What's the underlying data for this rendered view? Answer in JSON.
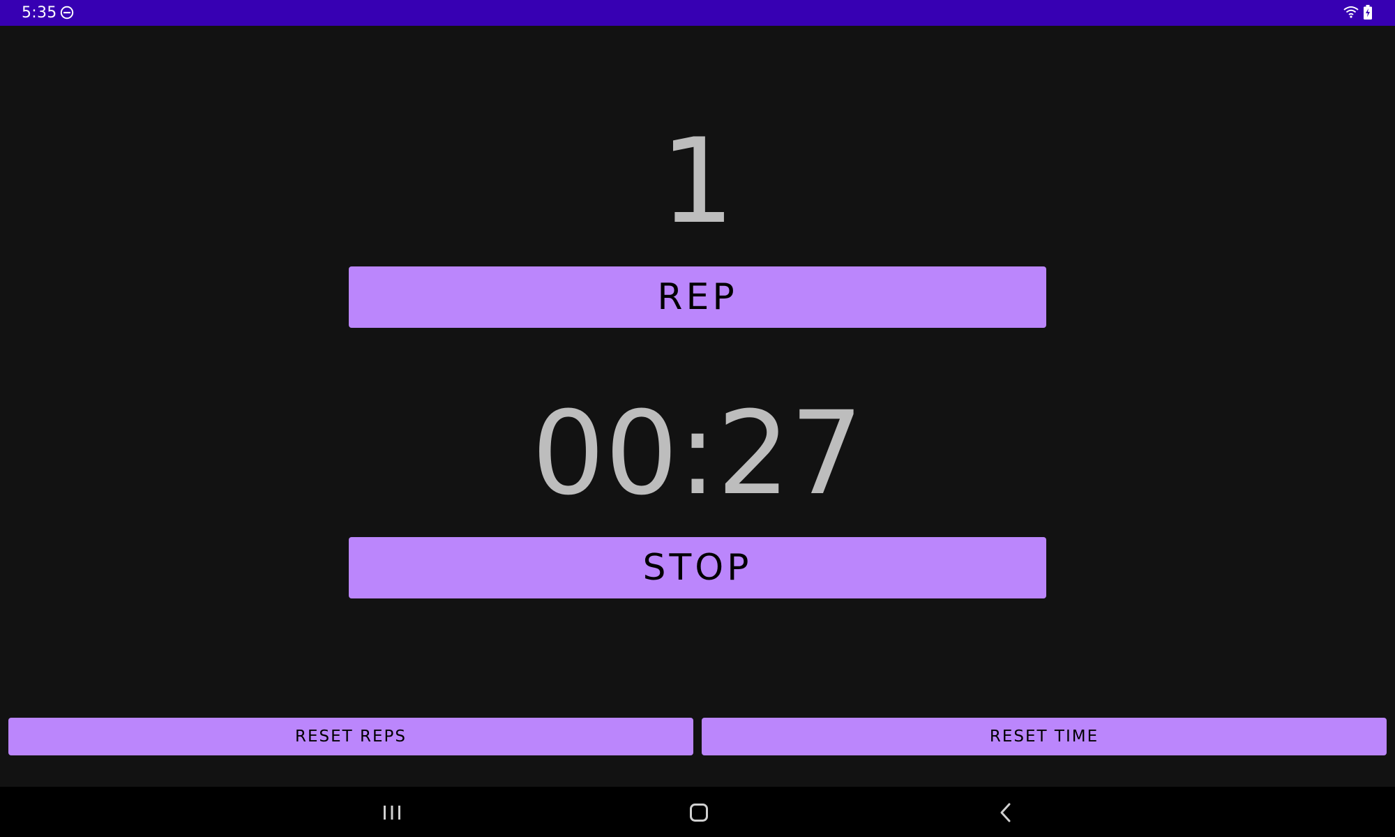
{
  "status_bar": {
    "time": "5:35",
    "icons": [
      "do-not-disturb-icon",
      "wifi-icon",
      "battery-charging-icon"
    ],
    "background": "#3700b3"
  },
  "main": {
    "rep_count": "1",
    "rep_button_label": "REP",
    "timer": "00:27",
    "stop_button_label": "STOP",
    "reset_reps_label": "RESET REPS",
    "reset_time_label": "RESET TIME"
  },
  "nav_bar": {
    "icons": [
      "recents-icon",
      "home-icon",
      "back-icon"
    ]
  },
  "colors": {
    "background": "#121212",
    "accent": "#bb86fc",
    "text_secondary": "#bdbdbd"
  }
}
